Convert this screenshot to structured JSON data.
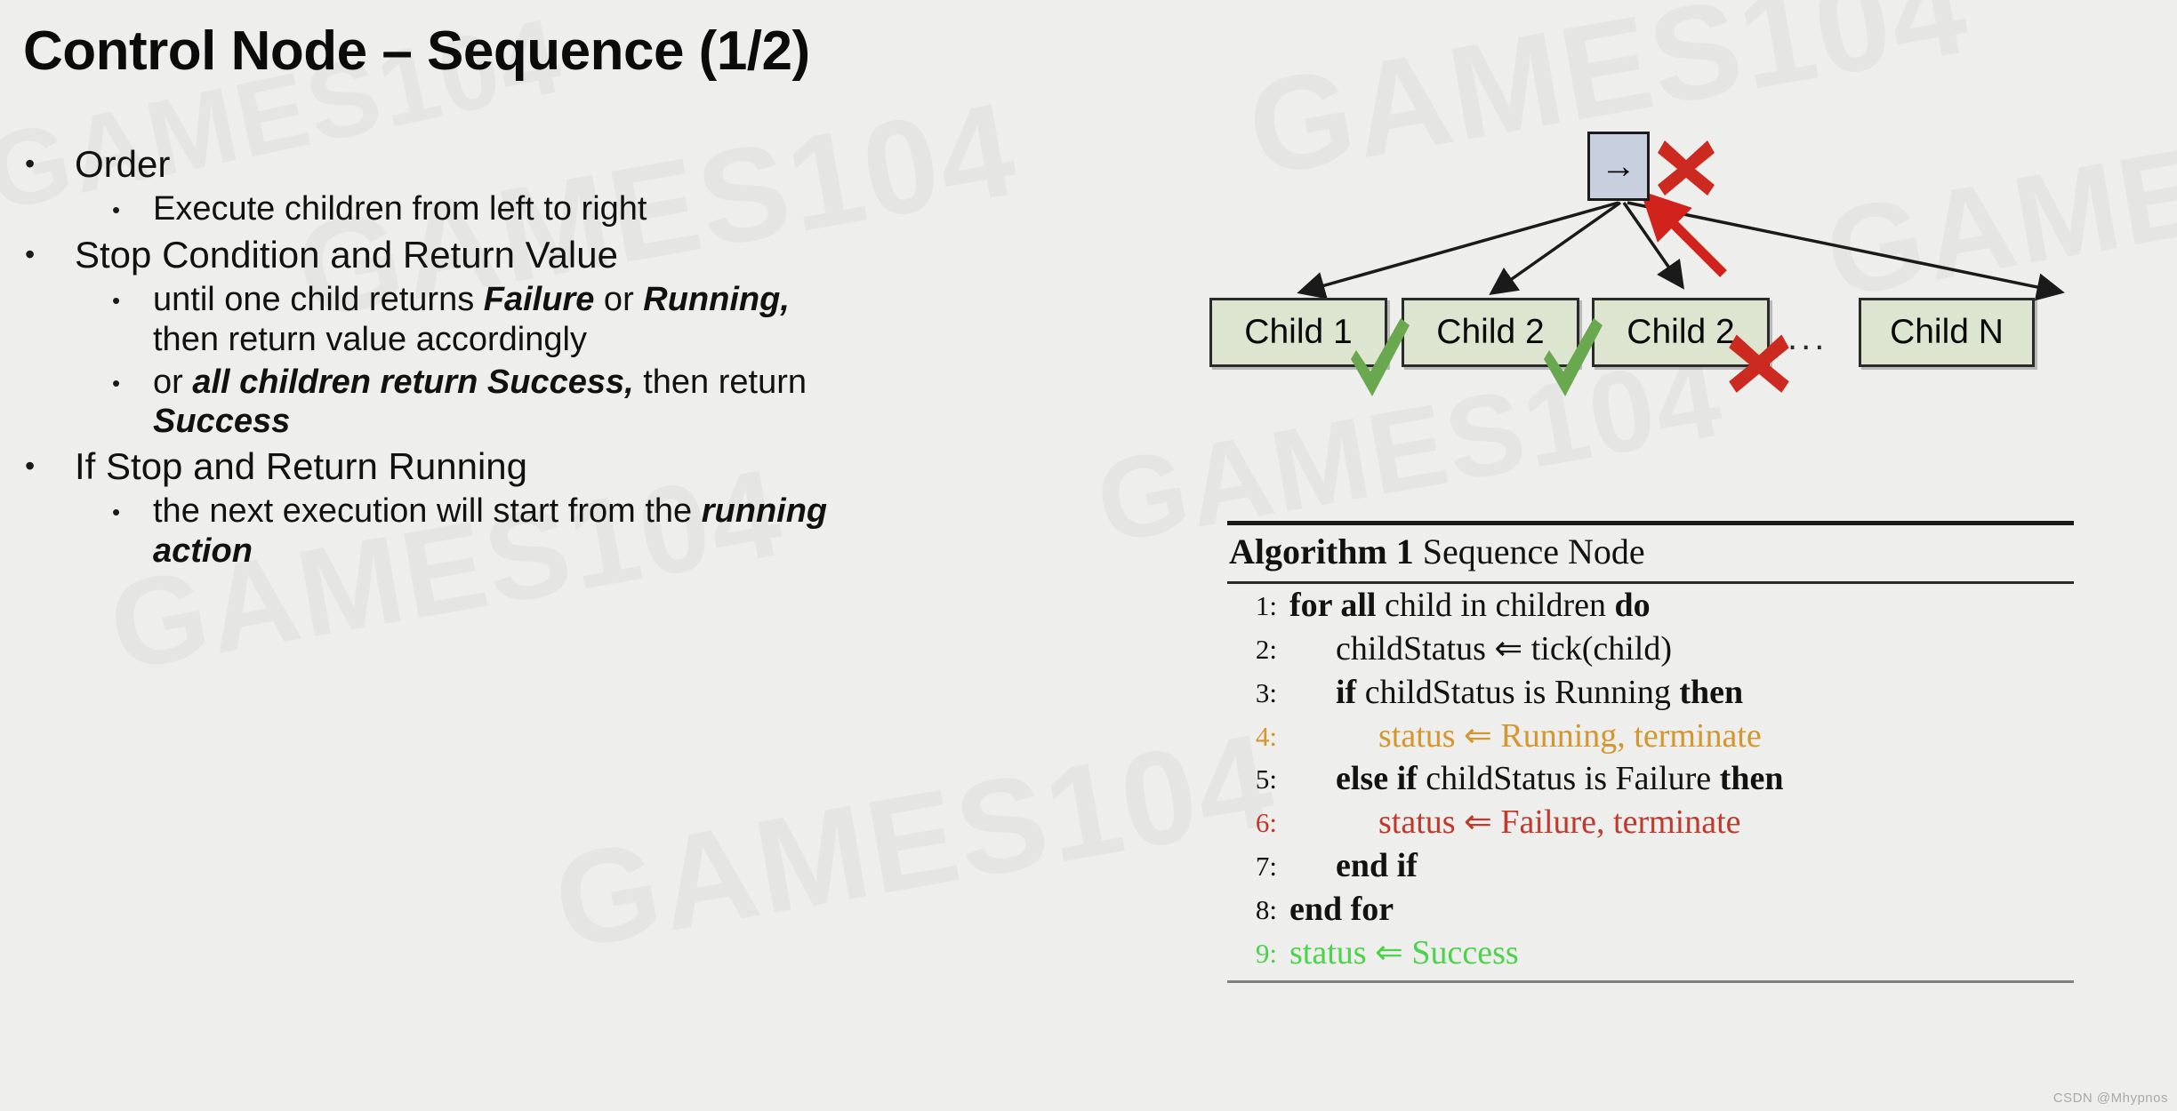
{
  "slide": {
    "title": "Control Node – Sequence (1/2)",
    "background_color": "#eeeeec",
    "watermark_text": "GAMES104",
    "footer_watermark": "CSDN @Mhypnos"
  },
  "bullets": {
    "b1": "Order",
    "b1_sub1": "Execute children from left to right",
    "b2": "Stop Condition and Return Value",
    "b2_sub1_pre": "until one child returns ",
    "b2_sub1_em1": "Failure",
    "b2_sub1_mid": " or ",
    "b2_sub1_em2": "Running,",
    "b2_sub1_cont": "then return value accordingly",
    "b2_sub2_pre": "or ",
    "b2_sub2_em1": "all children return Success,",
    "b2_sub2_post": "  then return",
    "b2_sub2_cont_em": "Success",
    "b3": "If Stop and Return Running",
    "b3_sub1_pre": "the next execution will start from the ",
    "b3_sub1_em1": "running",
    "b3_sub1_cont_em": "action"
  },
  "diagram": {
    "root": {
      "label": "→",
      "fill": "#c8cfdf",
      "status": "failed"
    },
    "children": [
      {
        "label": "Child 1",
        "status": "success",
        "mark": "check"
      },
      {
        "label": "Child 2",
        "status": "success",
        "mark": "check"
      },
      {
        "label": "Child 2",
        "status": "failure",
        "mark": "cross"
      },
      {
        "label": "Child N",
        "status": "none",
        "mark": "none"
      }
    ],
    "ellipsis": "...",
    "child_fill": "#dde5d0",
    "check_color": "#6aa84f",
    "cross_color": "#cc2a20",
    "return_arrow_color": "#d1221c"
  },
  "algorithm": {
    "name_bold": "Algorithm 1",
    "name_rest": " Sequence Node",
    "lines": [
      {
        "num": "1:",
        "indent": 0,
        "color": "black",
        "parts": [
          {
            "t": "for all",
            "kw": true
          },
          {
            "t": " child in children "
          },
          {
            "t": "do",
            "kw": true
          }
        ]
      },
      {
        "num": "2:",
        "indent": 1,
        "color": "black",
        "parts": [
          {
            "t": "childStatus ⇐ tick(child)"
          }
        ]
      },
      {
        "num": "3:",
        "indent": 1,
        "color": "black",
        "parts": [
          {
            "t": "if",
            "kw": true
          },
          {
            "t": " childStatus is Running "
          },
          {
            "t": "then",
            "kw": true
          }
        ]
      },
      {
        "num": "4:",
        "indent": 2,
        "color": "orange",
        "parts": [
          {
            "t": "status ⇐ Running, terminate"
          }
        ]
      },
      {
        "num": "5:",
        "indent": 1,
        "color": "black",
        "parts": [
          {
            "t": "else if",
            "kw": true
          },
          {
            "t": " childStatus is Failure "
          },
          {
            "t": "then",
            "kw": true
          }
        ]
      },
      {
        "num": "6:",
        "indent": 2,
        "color": "red",
        "parts": [
          {
            "t": "status ⇐ Failure, terminate"
          }
        ]
      },
      {
        "num": "7:",
        "indent": 1,
        "color": "black",
        "parts": [
          {
            "t": "end if",
            "kw": true
          }
        ]
      },
      {
        "num": "8:",
        "indent": 0,
        "color": "black",
        "parts": [
          {
            "t": "end for",
            "kw": true
          }
        ]
      },
      {
        "num": "9:",
        "indent": 0,
        "color": "green",
        "parts": [
          {
            "t": "status ⇐ Success"
          }
        ]
      }
    ]
  }
}
